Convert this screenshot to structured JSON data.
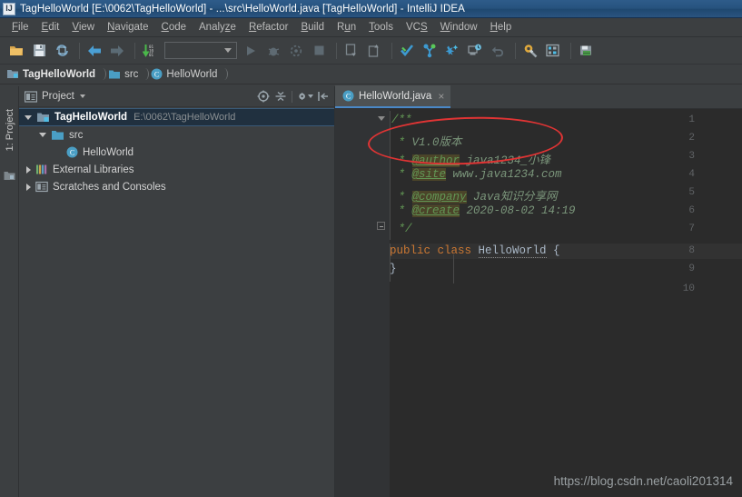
{
  "window": {
    "title": "TagHelloWorld [E:\\0062\\TagHelloWorld] - ...\\src\\HelloWorld.java [TagHelloWorld] - IntelliJ IDEA",
    "app_icon": "intellij-idea-logo-icon",
    "titlebar_color": "#2a5480"
  },
  "menubar": {
    "items": [
      {
        "label": "File",
        "mnemonic": "F"
      },
      {
        "label": "Edit",
        "mnemonic": "E"
      },
      {
        "label": "View",
        "mnemonic": "V"
      },
      {
        "label": "Navigate",
        "mnemonic": "N"
      },
      {
        "label": "Code",
        "mnemonic": "C"
      },
      {
        "label": "Analyze",
        "mnemonic": "z"
      },
      {
        "label": "Refactor",
        "mnemonic": "R"
      },
      {
        "label": "Build",
        "mnemonic": "B"
      },
      {
        "label": "Run",
        "mnemonic": "u"
      },
      {
        "label": "Tools",
        "mnemonic": "T"
      },
      {
        "label": "VCS",
        "mnemonic": "S"
      },
      {
        "label": "Window",
        "mnemonic": "W"
      },
      {
        "label": "Help",
        "mnemonic": "H"
      }
    ]
  },
  "toolbar": {
    "items": [
      {
        "name": "open-project-icon",
        "glyph": "folder"
      },
      {
        "name": "save-all-icon",
        "glyph": "floppy"
      },
      {
        "name": "sync-refresh-icon",
        "glyph": "sync"
      },
      {
        "name": "navigate-back-icon",
        "glyph": "arrow-left"
      },
      {
        "name": "navigate-forward-icon",
        "glyph": "arrow-right"
      },
      {
        "name": "compile-icon",
        "glyph": "compile"
      },
      {
        "name": "run-configurations-combo",
        "glyph": "combo",
        "value": ""
      },
      {
        "name": "run-icon",
        "glyph": "play"
      },
      {
        "name": "debug-icon",
        "glyph": "bug"
      },
      {
        "name": "run-coverage-icon",
        "glyph": "coverage"
      },
      {
        "name": "stop-icon",
        "glyph": "stop"
      },
      {
        "name": "update-project-icon",
        "glyph": "vcs-update"
      },
      {
        "name": "commit-icon",
        "glyph": "vcs-commit"
      },
      {
        "name": "check-commit-icon",
        "glyph": "check"
      },
      {
        "name": "vcs-branch-icon",
        "glyph": "branch"
      },
      {
        "name": "vcs-diff-icon",
        "glyph": "diff"
      },
      {
        "name": "vcs-history-icon",
        "glyph": "history"
      },
      {
        "name": "undo-icon",
        "glyph": "undo"
      },
      {
        "name": "settings-icon",
        "glyph": "gear-wrench"
      },
      {
        "name": "project-structure-icon",
        "glyph": "structure"
      },
      {
        "name": "sdk-manager-icon",
        "glyph": "sdk"
      }
    ]
  },
  "breadcrumb": {
    "items": [
      {
        "label": "TagHelloWorld",
        "icon": "module-icon",
        "bold": true
      },
      {
        "label": "src",
        "icon": "folder-icon",
        "bold": false
      },
      {
        "label": "HelloWorld",
        "icon": "class-icon",
        "bold": false
      }
    ]
  },
  "left_strip": {
    "project_tool": {
      "label": "1: Project",
      "mnemonic": "1",
      "icon": "project-window-icon"
    }
  },
  "project_panel": {
    "header": {
      "title": "Project",
      "icon": "project-view-icon",
      "actions": [
        {
          "name": "locate-file-icon",
          "glyph": "target"
        },
        {
          "name": "collapse-all-icon",
          "glyph": "collapse"
        },
        {
          "name": "settings-gear-icon",
          "glyph": "gear"
        },
        {
          "name": "hide-panel-icon",
          "glyph": "hide"
        }
      ]
    },
    "tree": [
      {
        "label": "TagHelloWorld",
        "path": "E:\\0062\\TagHelloWorld",
        "icon": "module-icon",
        "state": "expanded",
        "depth": 0,
        "selected": true,
        "bold": true
      },
      {
        "label": "src",
        "path": "",
        "icon": "source-folder-icon",
        "state": "expanded",
        "depth": 1,
        "selected": false,
        "bold": false
      },
      {
        "label": "HelloWorld",
        "path": "",
        "icon": "class-icon",
        "state": "leaf",
        "depth": 2,
        "selected": false,
        "bold": false
      },
      {
        "label": "External Libraries",
        "path": "",
        "icon": "libraries-icon",
        "state": "collapsed",
        "depth": 0,
        "selected": false,
        "bold": false
      },
      {
        "label": "Scratches and Consoles",
        "path": "",
        "icon": "scratches-icon",
        "state": "collapsed",
        "depth": 0,
        "selected": false,
        "bold": false
      }
    ]
  },
  "editor": {
    "tabs": [
      {
        "label": "HelloWorld.java",
        "icon": "class-icon",
        "active": true,
        "close": "×"
      }
    ],
    "line_numbers": [
      "1",
      "2",
      "3",
      "4",
      "5",
      "6",
      "7",
      "8",
      "9",
      "10"
    ],
    "code_lines": [
      {
        "n": 1,
        "tokens": [
          {
            "t": "/**",
            "c": "cmt"
          }
        ]
      },
      {
        "n": 2,
        "tokens": [
          {
            "t": " * ",
            "c": "cmt"
          },
          {
            "t": "V1.0版本",
            "c": "val"
          }
        ]
      },
      {
        "n": 3,
        "tokens": [
          {
            "t": " * ",
            "c": "cmt"
          },
          {
            "t": "@author",
            "c": "tag"
          },
          {
            "t": " java1234_小锋",
            "c": "val"
          }
        ]
      },
      {
        "n": 4,
        "tokens": [
          {
            "t": " * ",
            "c": "cmt"
          },
          {
            "t": "@site",
            "c": "tag"
          },
          {
            "t": " www.java1234.com",
            "c": "val"
          }
        ]
      },
      {
        "n": 5,
        "tokens": [
          {
            "t": " * ",
            "c": "cmt"
          },
          {
            "t": "@company",
            "c": "tag"
          },
          {
            "t": " Java知识分享网",
            "c": "val"
          }
        ]
      },
      {
        "n": 6,
        "tokens": [
          {
            "t": " * ",
            "c": "cmt"
          },
          {
            "t": "@create",
            "c": "tag"
          },
          {
            "t": " 2020-08-02 14:19",
            "c": "val"
          }
        ]
      },
      {
        "n": 7,
        "tokens": [
          {
            "t": " */",
            "c": "cmt"
          }
        ]
      },
      {
        "n": 8,
        "tokens": [
          {
            "t": "public class ",
            "c": "kw"
          },
          {
            "t": "HelloWorld",
            "c": "cls"
          },
          {
            "t": " {",
            "c": "brc"
          }
        ]
      },
      {
        "n": 9,
        "tokens": [
          {
            "t": "}",
            "c": "brc"
          }
        ]
      },
      {
        "n": 10,
        "tokens": []
      }
    ],
    "annotation": {
      "type": "ellipse",
      "color": "#e03434",
      "target_text": "V1.0版本"
    }
  },
  "watermark": {
    "text": "https://blog.csdn.net/caoli201314"
  },
  "colors": {
    "titlebar": "#2a5480",
    "chrome": "#3c3f41",
    "editor_bg": "#2b2b2b",
    "gutter_bg": "#313335",
    "selection": "#20303f",
    "tab_active_underline": "#4a88c7",
    "annotation_red": "#e03434",
    "keyword_orange": "#cc7832",
    "comment_green": "#629755",
    "javadoc_value": "#7b967b",
    "tag_highlight": "#4b4429"
  }
}
